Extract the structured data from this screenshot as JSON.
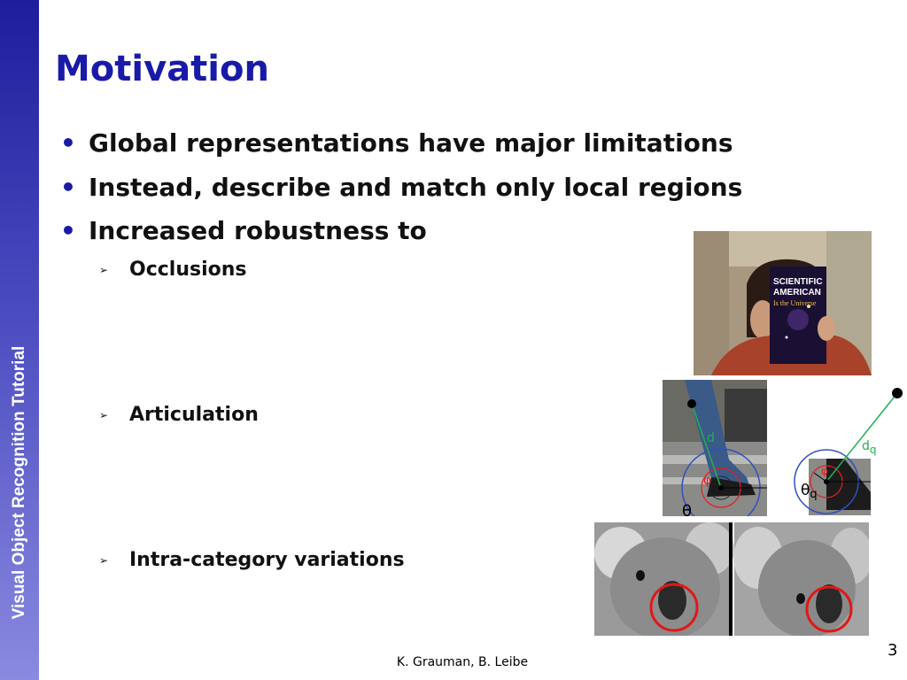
{
  "sidebar": {
    "text": "Visual Object Recognition Tutorial"
  },
  "slide": {
    "title": "Motivation",
    "bullets": [
      "Global representations have major limitations",
      "Instead, describe and match only local regions",
      "Increased robustness to"
    ],
    "subbullets": [
      "Occlusions",
      "Articulation",
      "Intra-category variations"
    ]
  },
  "magazine": {
    "line1": "SCIENTIFIC",
    "line2": "AMERICAN",
    "line3": "Is the Universe"
  },
  "articulation": {
    "left": {
      "d": "d",
      "phi": "φ",
      "theta": "θ"
    },
    "right": {
      "d": "d",
      "d_sub": "q",
      "phi": "φ",
      "theta": "θ",
      "theta_sub": "q"
    }
  },
  "footer": {
    "authors": "K. Grauman, B. Leibe",
    "page": "3"
  },
  "colors": {
    "title": "#1a1aa8",
    "sidebar": "#3333b0",
    "green": "#22b050",
    "red": "#e02020",
    "blue": "#3050c0"
  }
}
